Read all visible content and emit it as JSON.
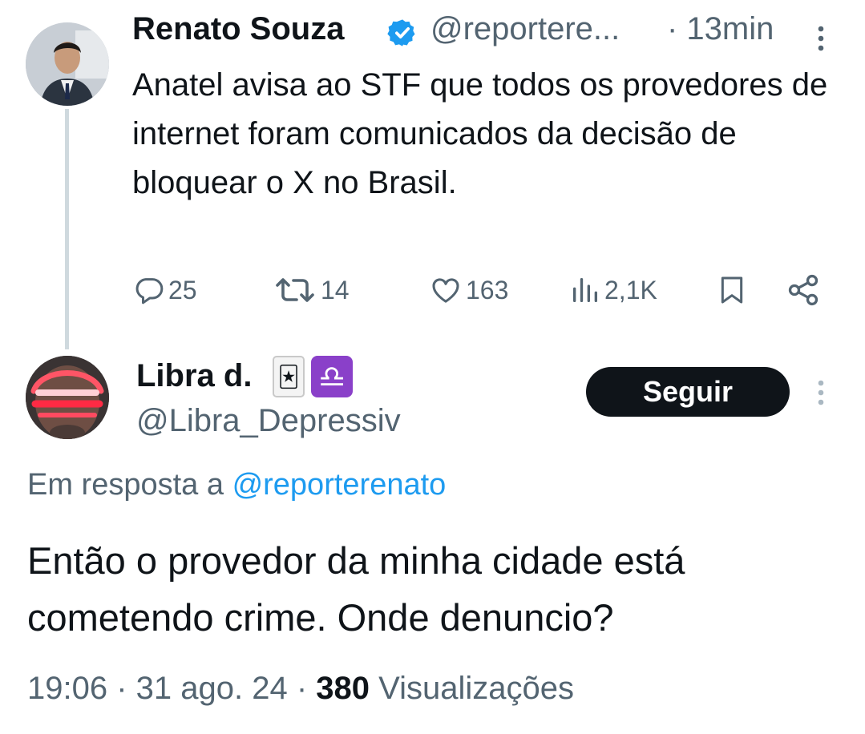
{
  "tweet1": {
    "author_name": "Renato Souza",
    "handle": "@reportere...",
    "time": "· 13min",
    "text": "Anatel avisa ao STF que todos os provedores de internet foram comunicados da decisão de bloquear o X no Brasil.",
    "verified": true,
    "actions": {
      "replies": "25",
      "retweets": "14",
      "likes": "163",
      "views": "2,1K"
    }
  },
  "tweet2": {
    "author_name": "Libra d.",
    "emoji_1": "🃏",
    "emoji_2": "♎",
    "handle": "@Libra_Depressiv",
    "follow_label": "Seguir",
    "reply_prefix": "Em resposta a",
    "reply_mention": "@reporterenato",
    "text": "Então o provedor da minha cidade está cometendo crime. Onde denuncio?",
    "time": "19:06",
    "date": "31 ago. 24",
    "views_count": "380",
    "views_label": "Visualizações"
  },
  "colors": {
    "text": "#0f1419",
    "secondary": "#536471",
    "accent": "#1d9bf0",
    "thread_line": "#cfd9de",
    "follow_bg": "#0f1419"
  },
  "icons": [
    "reply-icon",
    "retweet-icon",
    "like-icon",
    "views-icon",
    "bookmark-icon",
    "share-icon",
    "more-icon",
    "verified-icon"
  ]
}
